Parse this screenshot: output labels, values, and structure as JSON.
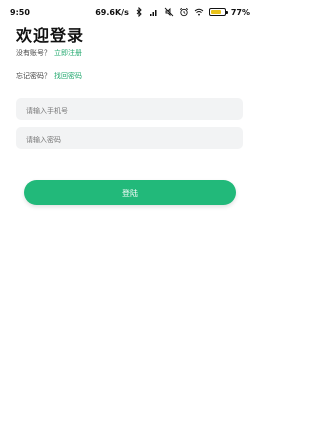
{
  "status_bar": {
    "time": "9:50",
    "net_speed": "69.6K/s",
    "battery_percent": "77%",
    "battery_level": 0.77,
    "icons": [
      "bluetooth-icon",
      "signal-icon",
      "mute-icon",
      "alarm-icon",
      "wifi-icon",
      "battery-icon"
    ]
  },
  "welcome": {
    "title": "欢迎登录"
  },
  "register": {
    "prompt": "没有账号？",
    "link": "立即注册"
  },
  "forgot": {
    "prompt": "忘记密码？",
    "link": "找回密码"
  },
  "form": {
    "phone_placeholder": "请输入手机号",
    "password_placeholder": "请输入密码",
    "phone_value": "",
    "password_value": ""
  },
  "login": {
    "button_label": "登陆"
  },
  "colors": {
    "accent": "#22b97a",
    "link": "#22a86e",
    "input_bg": "#f2f3f4"
  }
}
